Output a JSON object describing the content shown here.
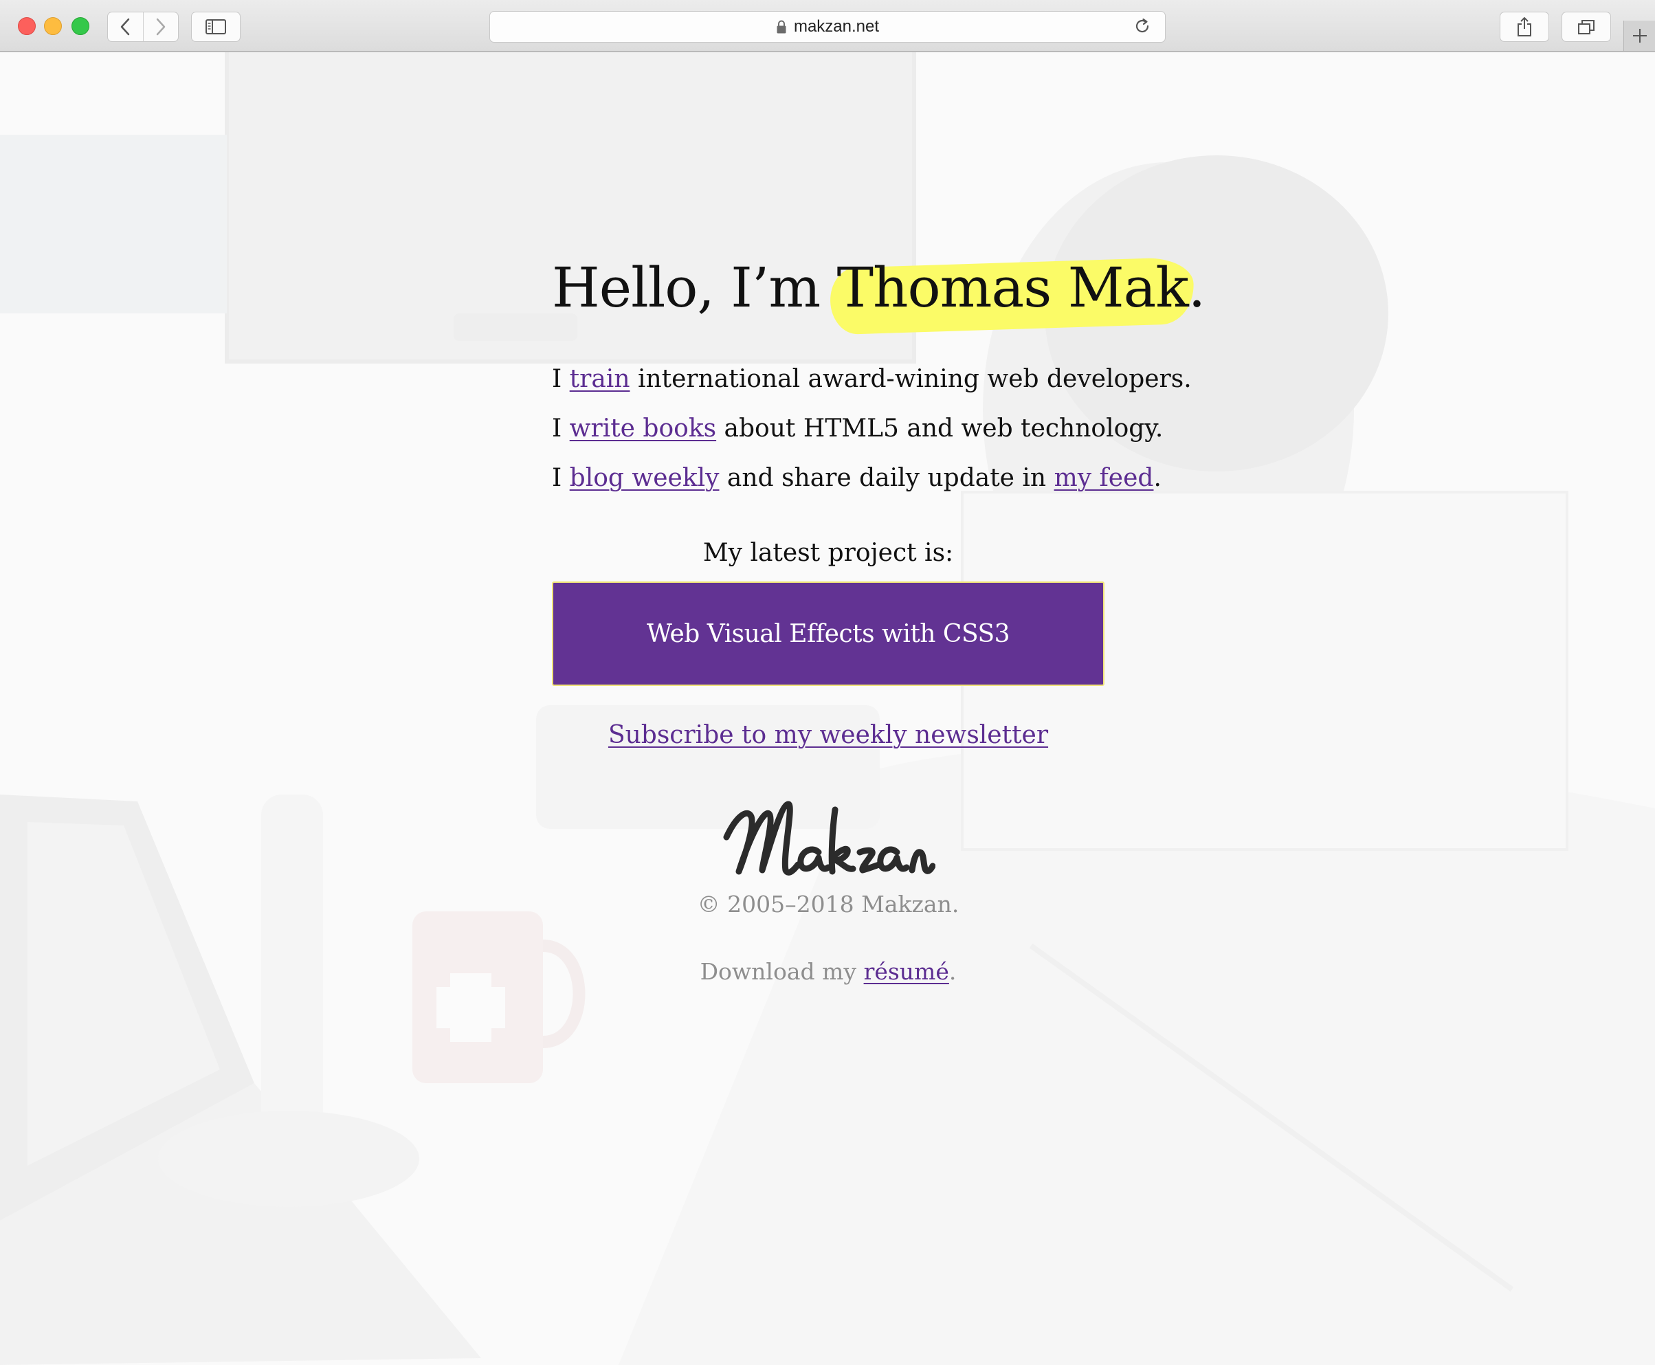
{
  "browser": {
    "url": "makzan.net",
    "icons": {
      "close": "close-button",
      "minimize": "minimize-button",
      "maximize": "maximize-button",
      "back": "chevron-left-icon",
      "forward": "chevron-right-icon",
      "sidebar": "sidebar-icon",
      "lock": "lock-icon",
      "reload": "reload-icon",
      "share": "share-icon",
      "tabs": "tabs-icon",
      "new_tab": "plus-icon"
    }
  },
  "hero": {
    "greeting": "Hello, I’m ",
    "name": "Thomas Mak",
    "period": "."
  },
  "intro": {
    "line1": {
      "prefix": "I ",
      "link": "train",
      "suffix": " international award-wining web developers."
    },
    "line2": {
      "prefix": "I ",
      "link": "write books",
      "suffix": " about HTML5 and web technology."
    },
    "line3": {
      "prefix": "I ",
      "link": "blog weekly",
      "middle": " and share daily update in ",
      "link2": "my feed",
      "suffix": "."
    }
  },
  "project": {
    "label": "My latest project is:",
    "button": "Web Visual Effects with CSS3"
  },
  "subscribe_link": "Subscribe to my weekly newsletter",
  "footer": {
    "signature": "Makzan",
    "copyright": "© 2005–2018 Makzan.",
    "download_prefix": "Download my ",
    "download_link": "résumé",
    "download_suffix": "."
  },
  "colors": {
    "link": "#5c2d91",
    "button_bg": "#623393",
    "highlight": "#fbfb67",
    "muted_text": "#8e8e8e"
  }
}
